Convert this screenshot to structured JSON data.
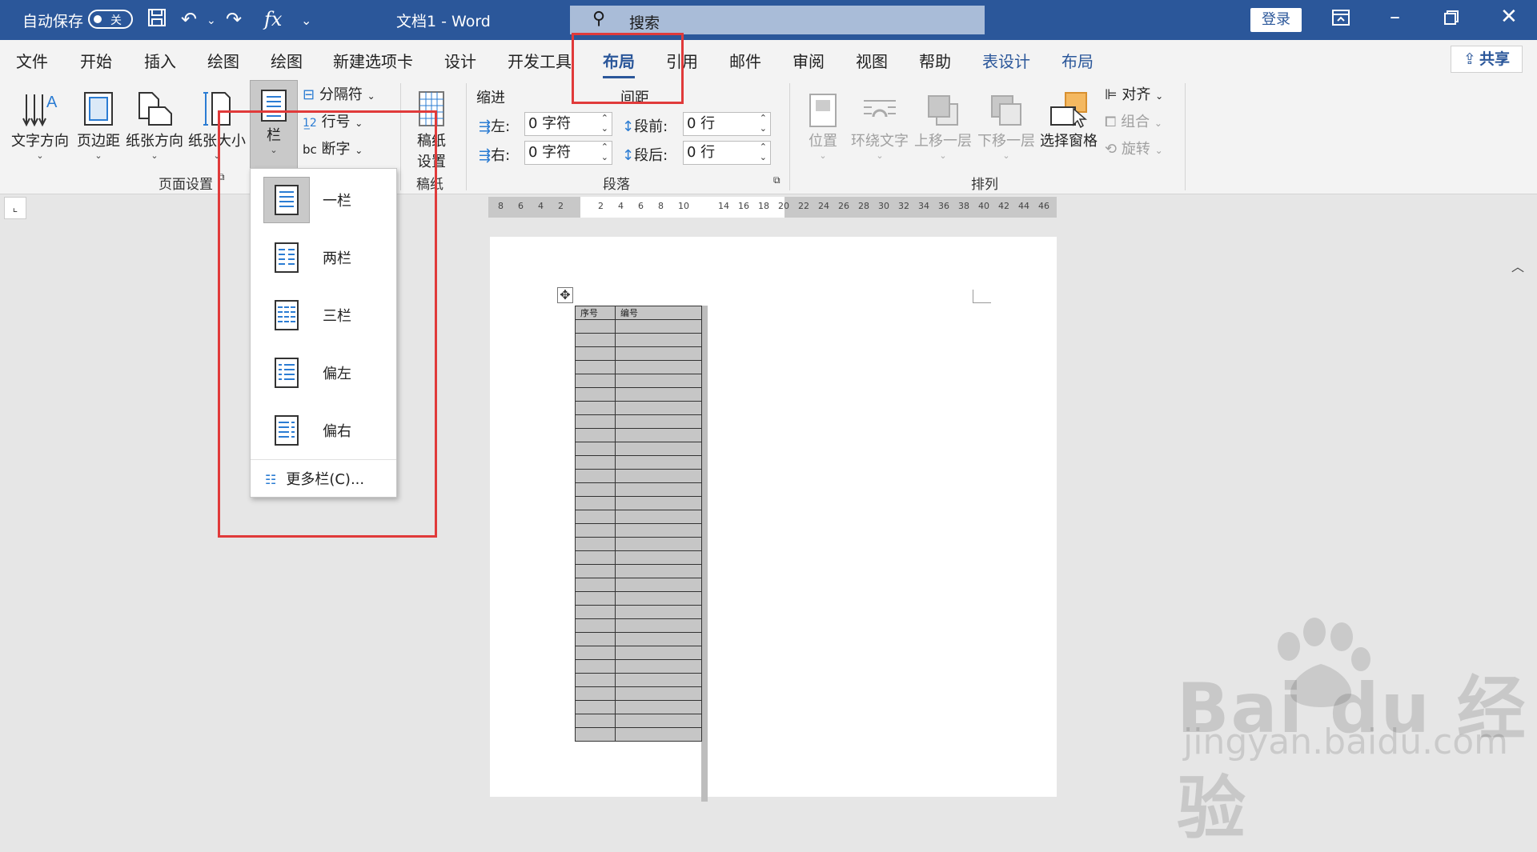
{
  "titlebar": {
    "autosave_label": "自动保存",
    "autosave_state": "关",
    "doc_title": "文档1  -  Word",
    "search_placeholder": "搜索",
    "login_label": "登录"
  },
  "tabs": [
    "文件",
    "开始",
    "插入",
    "绘图",
    "绘图",
    "新建选项卡",
    "设计",
    "开发工具",
    "布局",
    "引用",
    "邮件",
    "审阅",
    "视图",
    "帮助",
    "表设计",
    "布局"
  ],
  "share_label": "共享",
  "ribbon": {
    "page_setup": {
      "text_direction": "文字方向",
      "margins": "页边距",
      "orientation": "纸张方向",
      "size": "纸张大小",
      "columns": "栏",
      "breaks": "分隔符",
      "line_numbers": "行号",
      "hyphenation": "断字",
      "group_label": "页面设置"
    },
    "manuscript": {
      "button_line1": "稿纸",
      "button_line2": "设置",
      "group_label": "稿纸"
    },
    "paragraph": {
      "indent_heading": "缩进",
      "spacing_heading": "间距",
      "left_label": "左:",
      "left_value": "0 字符",
      "right_label": "右:",
      "right_value": "0 字符",
      "before_label": "段前:",
      "before_value": "0 行",
      "after_label": "段后:",
      "after_value": "0 行",
      "group_label": "段落"
    },
    "arrange": {
      "position": "位置",
      "wrap_text": "环绕文字",
      "bring_forward": "上移一层",
      "send_backward": "下移一层",
      "selection_pane": "选择窗格",
      "align": "对齐",
      "group": "组合",
      "rotate": "旋转",
      "group_label": "排列"
    }
  },
  "ruler_numbers": [
    "8",
    "6",
    "4",
    "2",
    "2",
    "4",
    "6",
    "8",
    "10",
    "14",
    "16",
    "18",
    "20",
    "22",
    "24",
    "26",
    "28",
    "30",
    "32",
    "34",
    "36",
    "38",
    "40",
    "42",
    "44",
    "46"
  ],
  "columns_menu": {
    "items": [
      "一栏",
      "两栏",
      "三栏",
      "偏左",
      "偏右"
    ],
    "selected": "一栏",
    "more": "更多栏(C)..."
  },
  "table": {
    "headers": [
      "序号",
      "编号"
    ]
  },
  "watermark": {
    "brand": "Bai du 经验",
    "url": "jingyan.baidu.com"
  }
}
